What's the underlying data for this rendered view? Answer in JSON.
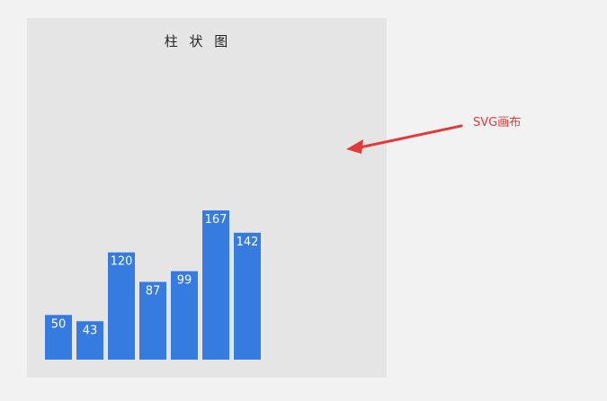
{
  "chart_data": {
    "type": "bar",
    "title": "柱 状 图",
    "categories": [
      "",
      "",
      "",
      "",
      "",
      "",
      ""
    ],
    "values": [
      50,
      43,
      120,
      87,
      99,
      167,
      142
    ],
    "xlabel": "",
    "ylabel": "",
    "ylim": [
      0,
      167
    ],
    "grid": false,
    "colors": {
      "bar": "#367bdf",
      "label": "#ffffff",
      "background": "#e5e5e5"
    }
  },
  "annotation": {
    "label": "SVG画布",
    "color": "#e03a3a"
  }
}
